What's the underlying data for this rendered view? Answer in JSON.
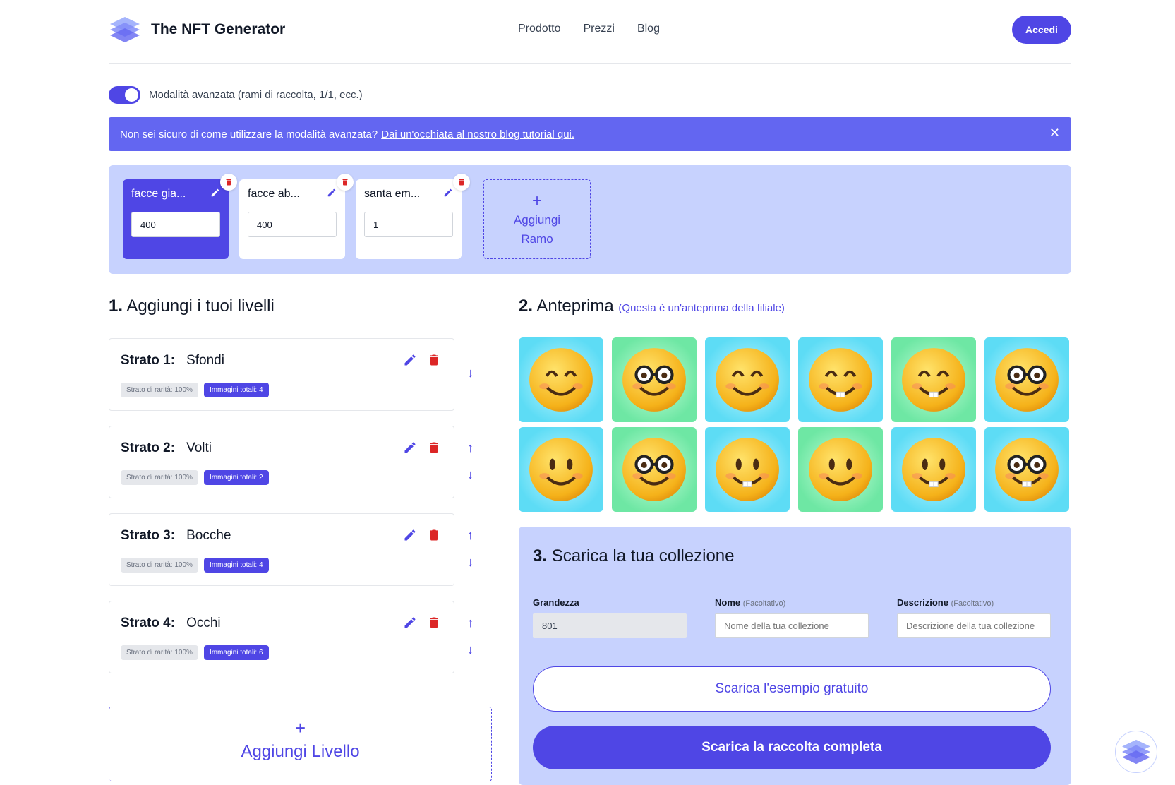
{
  "header": {
    "brand": "The NFT Generator",
    "nav": [
      "Prodotto",
      "Prezzi",
      "Blog"
    ],
    "login_label": "Accedi"
  },
  "toggle": {
    "label": "Modalità avanzata (rami di raccolta, 1/1, ecc.)",
    "on": true
  },
  "banner": {
    "text": "Non sei sicuro di come utilizzare la modalità avanzata?",
    "link": "Dai un'occhiata al nostro blog tutorial qui.",
    "close": "✕"
  },
  "branches": [
    {
      "name": "facce gia...",
      "value": "400",
      "active": true
    },
    {
      "name": "facce ab...",
      "value": "400",
      "active": false
    },
    {
      "name": "santa em...",
      "value": "1",
      "active": false
    }
  ],
  "add_branch": {
    "plus": "+",
    "line1": "Aggiungi",
    "line2": "Ramo"
  },
  "layers_section": {
    "num": "1.",
    "title": "Aggiungi i tuoi livelli"
  },
  "layers": [
    {
      "label": "Strato 1:",
      "name": "Sfondi",
      "rarity": "Strato di rarità: 100%",
      "total": "Immagini totali: 4"
    },
    {
      "label": "Strato 2:",
      "name": "Volti",
      "rarity": "Strato di rarità: 100%",
      "total": "Immagini totali: 2"
    },
    {
      "label": "Strato 3:",
      "name": "Bocche",
      "rarity": "Strato di rarità: 100%",
      "total": "Immagini totali: 4"
    },
    {
      "label": "Strato 4:",
      "name": "Occhi",
      "rarity": "Strato di rarità: 100%",
      "total": "Immagini totali: 6"
    }
  ],
  "add_layer": {
    "plus": "+",
    "label": "Aggiungi Livello"
  },
  "preview": {
    "num": "2.",
    "title": "Anteprima",
    "subtitle": "(Questa è un'anteprima della filiale)",
    "cells": [
      {
        "bg": "blue",
        "face": "smile"
      },
      {
        "bg": "green",
        "face": "glasses"
      },
      {
        "bg": "blue",
        "face": "smile"
      },
      {
        "bg": "blue",
        "face": "teeth"
      },
      {
        "bg": "green",
        "face": "teeth"
      },
      {
        "bg": "blue",
        "face": "glasses"
      },
      {
        "bg": "blue",
        "face": "plain"
      },
      {
        "bg": "green",
        "face": "glasses"
      },
      {
        "bg": "blue",
        "face": "plain-teeth"
      },
      {
        "bg": "green",
        "face": "plain"
      },
      {
        "bg": "blue",
        "face": "plain-teeth"
      },
      {
        "bg": "blue",
        "face": "glasses-teeth"
      }
    ]
  },
  "download": {
    "num": "3.",
    "title": "Scarica la tua collezione",
    "size_label": "Grandezza",
    "size_value": "801",
    "name_label": "Nome",
    "name_optional": "(Facoltativo)",
    "name_placeholder": "Nome della tua collezione",
    "desc_label": "Descrizione",
    "desc_optional": "(Facoltativo)",
    "desc_placeholder": "Descrizione della tua collezione",
    "free_button": "Scarica l'esempio gratuito",
    "full_button": "Scarica la raccolta completa"
  },
  "colors": {
    "accent": "#4f46e5",
    "banner": "#6366f1",
    "panel": "#c7d2fe",
    "danger": "#dc2626"
  }
}
